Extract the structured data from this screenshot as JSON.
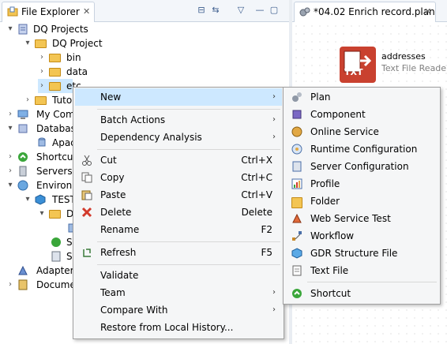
{
  "left_tab": {
    "title": "File Explorer",
    "close": "✕"
  },
  "left_toolbar": {
    "collapse": "⊟",
    "link": "⇆",
    "menu": "▽",
    "minimize": "—",
    "maximize": "▢"
  },
  "right_tab": {
    "title": "*04.02 Enrich record.plan",
    "close": "✕"
  },
  "tree": {
    "dq_projects": "DQ Projects",
    "dq_project": "DQ Project",
    "bin": "bin",
    "data": "data",
    "etc": "etc",
    "tuto": "Tuto",
    "my_com": "My Com",
    "database": "Database",
    "apac": "Apac",
    "shortcut": "Shortcut",
    "servers": "Servers",
    "environ": "Environm",
    "test": "TEST",
    "d": "D",
    "s1": "S",
    "s2": "S",
    "adapters": "Adapters",
    "docume": "Docume"
  },
  "canvas_step": {
    "name": "addresses",
    "type": "Text File Reader",
    "icon_label": "TXT"
  },
  "context_menu": {
    "new": "New",
    "batch_actions": "Batch Actions",
    "dependency_analysis": "Dependency Analysis",
    "cut": "Cut",
    "cut_key": "Ctrl+X",
    "copy": "Copy",
    "copy_key": "Ctrl+C",
    "paste": "Paste",
    "paste_key": "Ctrl+V",
    "delete": "Delete",
    "delete_key": "Delete",
    "rename": "Rename",
    "rename_key": "F2",
    "refresh": "Refresh",
    "refresh_key": "F5",
    "validate": "Validate",
    "team": "Team",
    "compare_with": "Compare With",
    "restore": "Restore from Local History...",
    "arrow": "›"
  },
  "submenu": {
    "plan": "Plan",
    "component": "Component",
    "online_service": "Online Service",
    "runtime_configuration": "Runtime Configuration",
    "server_configuration": "Server Configuration",
    "profile": "Profile",
    "folder": "Folder",
    "web_service_test": "Web Service Test",
    "workflow": "Workflow",
    "gdr_structure_file": "GDR Structure File",
    "text_file": "Text File",
    "shortcut": "Shortcut"
  }
}
